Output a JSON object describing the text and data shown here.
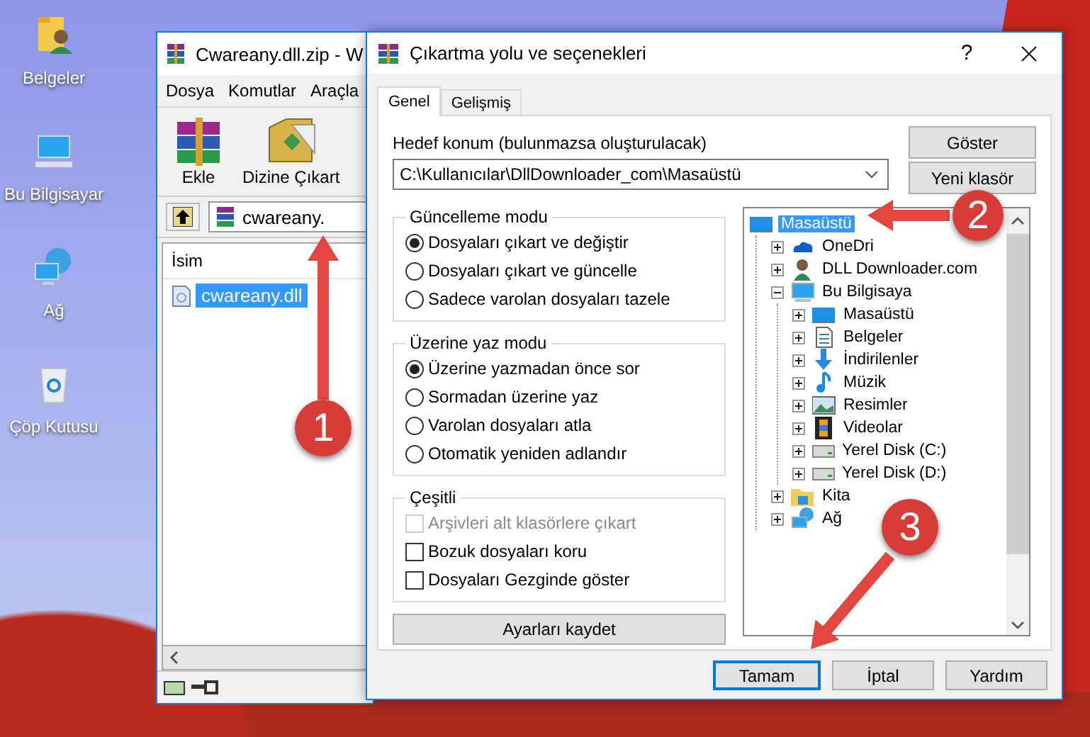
{
  "desktop_icons": [
    {
      "label": "Belgeler",
      "kind": "documents"
    },
    {
      "label": "Bu Bilgisayar",
      "kind": "computer"
    },
    {
      "label": "Ağ",
      "kind": "network"
    },
    {
      "label": "Çöp Kutusu",
      "kind": "bin"
    }
  ],
  "archive_window": {
    "title": "Cwareany.dll.zip - W",
    "menu": [
      "Dosya",
      "Komutlar",
      "Araçla"
    ],
    "toolbar": [
      {
        "label": "Ekle",
        "kind": "add"
      },
      {
        "label": "Dizine Çıkart",
        "kind": "extract"
      }
    ],
    "path": "cwareany.",
    "columns": [
      "İsim"
    ],
    "files": [
      {
        "name": "cwareany.dll",
        "selected": true
      }
    ]
  },
  "dialog": {
    "title": "Çıkartma yolu ve seçenekleri",
    "help": "?",
    "tabs": [
      {
        "label": "Genel",
        "selected": true
      },
      {
        "label": "Gelişmiş",
        "selected": false
      }
    ],
    "destination_label": "Hedef konum (bulunmazsa oluşturulacak)",
    "destination": "C:\\Kullanıcılar\\DllDownloader_com\\Masaüstü",
    "side_buttons": [
      "Göster",
      "Yeni klasör"
    ],
    "groups": [
      {
        "title": "Güncelleme modu",
        "options": [
          {
            "kind": "radio",
            "label": "Dosyaları çıkart ve değiştir",
            "selected": true
          },
          {
            "kind": "radio",
            "label": "Dosyaları çıkart ve güncelle",
            "selected": false
          },
          {
            "kind": "radio",
            "label": "Sadece varolan dosyaları tazele",
            "selected": false
          }
        ]
      },
      {
        "title": "Üzerine yaz modu",
        "options": [
          {
            "kind": "radio",
            "label": "Üzerine yazmadan önce sor",
            "selected": true
          },
          {
            "kind": "radio",
            "label": "Sormadan üzerine yaz",
            "selected": false
          },
          {
            "kind": "radio",
            "label": "Varolan dosyaları atla",
            "selected": false
          },
          {
            "kind": "radio",
            "label": "Otomatik yeniden adlandır",
            "selected": false
          }
        ]
      },
      {
        "title": "Çeşitli",
        "options": [
          {
            "kind": "checkbox",
            "label": "Arşivleri alt klasörlere çıkart",
            "checked": false,
            "disabled": true
          },
          {
            "kind": "checkbox",
            "label": "Bozuk dosyaları koru",
            "checked": false,
            "disabled": false
          },
          {
            "kind": "checkbox",
            "label": "Dosyaları Gezginde göster",
            "checked": false,
            "disabled": false
          }
        ]
      }
    ],
    "save_button": "Ayarları kaydet",
    "tree": [
      {
        "label": "Masaüstü",
        "kind": "desktop",
        "selected": true,
        "children": [
          {
            "label": "OneDri",
            "kind": "cloud",
            "selected": false,
            "expanded": false
          },
          {
            "label": "DLL Downloader.com",
            "kind": "user",
            "selected": false,
            "expanded": false
          },
          {
            "label": "Bu Bilgisaya",
            "kind": "computer",
            "selected": false,
            "expanded": true,
            "children": [
              {
                "label": "Masaüstü",
                "kind": "desktop",
                "selected": false,
                "expanded": false
              },
              {
                "label": "Belgeler",
                "kind": "document",
                "selected": false,
                "expanded": false
              },
              {
                "label": "İndirilenler",
                "kind": "download",
                "selected": false,
                "expanded": false
              },
              {
                "label": "Müzik",
                "kind": "music",
                "selected": false,
                "expanded": false
              },
              {
                "label": "Resimler",
                "kind": "picture",
                "selected": false,
                "expanded": false
              },
              {
                "label": "Videolar",
                "kind": "video",
                "selected": false,
                "expanded": false
              },
              {
                "label": "Yerel Disk (C:)",
                "kind": "disk",
                "selected": false,
                "expanded": false
              },
              {
                "label": "Yerel Disk (D:)",
                "kind": "disk",
                "selected": false,
                "expanded": false
              }
            ]
          },
          {
            "label": "Kita",
            "kind": "library",
            "selected": false,
            "expanded": false
          },
          {
            "label": "Ağ",
            "kind": "network",
            "selected": false,
            "expanded": false
          }
        ]
      }
    ],
    "buttons": [
      {
        "label": "Tamam",
        "default": true
      },
      {
        "label": "İptal",
        "default": false
      },
      {
        "label": "Yardım",
        "default": false
      }
    ]
  },
  "annotations": [
    {
      "label": "1"
    },
    {
      "label": "2"
    },
    {
      "label": "3"
    }
  ]
}
